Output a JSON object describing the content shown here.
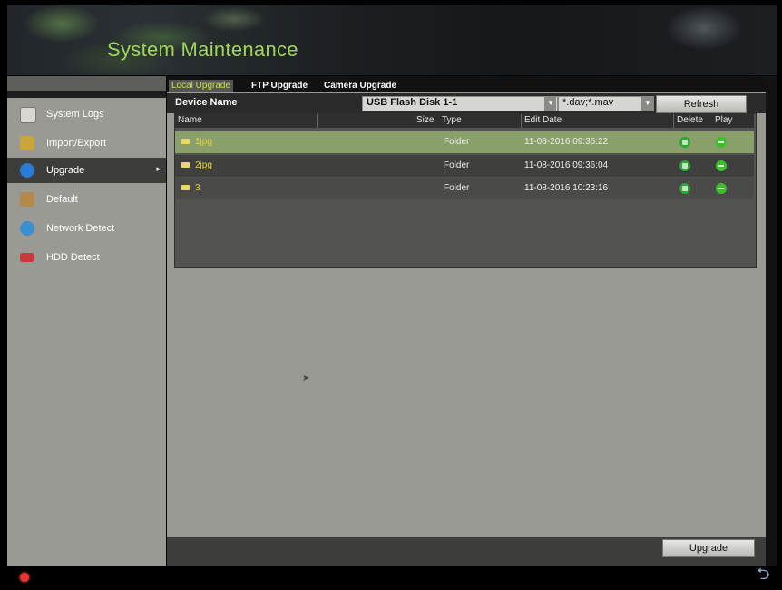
{
  "header": {
    "title": "System Maintenance"
  },
  "sidebar": {
    "items": [
      {
        "label": "System Logs",
        "icon": "log-icon",
        "color": "#d8d8d0"
      },
      {
        "label": "Import/Export",
        "icon": "import-export-icon",
        "color": "#c9a63a"
      },
      {
        "label": "Upgrade",
        "icon": "upgrade-icon",
        "color": "#2a7bd6"
      },
      {
        "label": "Default",
        "icon": "default-icon",
        "color": "#b38a4a"
      },
      {
        "label": "Network Detect",
        "icon": "network-icon",
        "color": "#3a8fd0"
      },
      {
        "label": "HDD Detect",
        "icon": "hdd-icon",
        "color": "#c83a3a"
      }
    ],
    "active": "Upgrade"
  },
  "tabs": [
    "Local Upgrade",
    "FTP Upgrade",
    "Camera Upgrade"
  ],
  "device": {
    "label": "Device Name",
    "value": "USB Flash Disk 1-1",
    "ext": "*.dav;*.mav",
    "refresh": "Refresh"
  },
  "table": {
    "headers": [
      "Name",
      "Size",
      "Type",
      "Edit Date",
      "Delete",
      "Play"
    ],
    "rows": [
      {
        "name": "1jpg",
        "type": "Folder",
        "date": "11-08-2016 09:35:22"
      },
      {
        "name": "2jpg",
        "type": "Folder",
        "date": "11-08-2016 09:36:04"
      },
      {
        "name": "3",
        "type": "Folder",
        "date": "11-08-2016 10:23:16"
      }
    ]
  },
  "buttons": {
    "upgrade": "Upgrade"
  },
  "colors": {
    "accent": "#9fd65a",
    "selected_row": "#8aa06a",
    "tab_active_text": "#c9e24a"
  }
}
